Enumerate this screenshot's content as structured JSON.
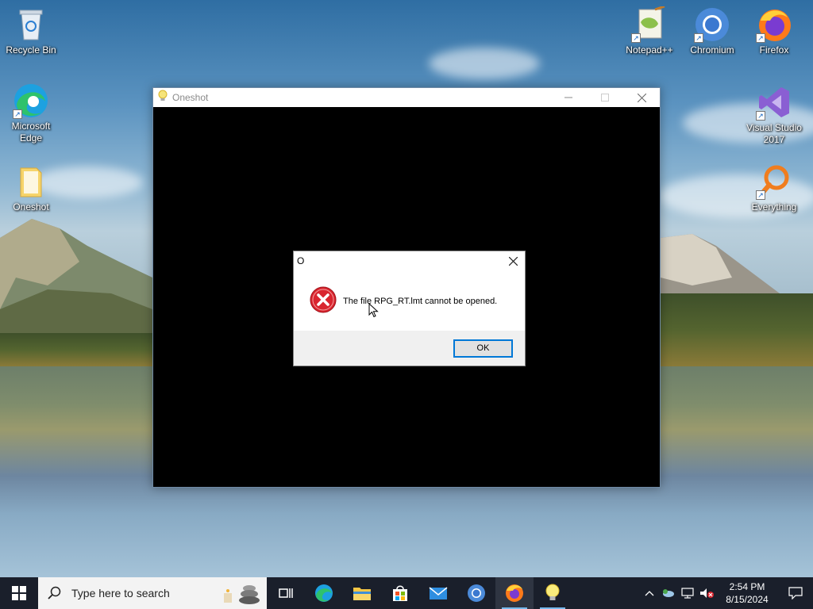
{
  "desktop": {
    "icons_left": [
      {
        "label": "Recycle Bin",
        "icon": "recycle-bin-icon"
      },
      {
        "label": "Microsoft Edge",
        "icon": "edge-icon"
      },
      {
        "label": "Oneshot",
        "icon": "folder-icon"
      }
    ],
    "icons_right": [
      {
        "label": "Notepad++",
        "icon": "notepad-plus-plus-icon"
      },
      {
        "label": "Chromium",
        "icon": "chromium-icon"
      },
      {
        "label": "Firefox",
        "icon": "firefox-icon"
      },
      {
        "label": "Visual Studio 2017",
        "icon": "visual-studio-icon"
      },
      {
        "label": "Everything",
        "icon": "everything-search-icon"
      }
    ]
  },
  "window": {
    "title": "Oneshot",
    "icon": "lightbulb-icon",
    "controls": [
      "minimize",
      "maximize",
      "close"
    ]
  },
  "dialog": {
    "title": "O",
    "message": "The file RPG_RT.lmt cannot be opened.",
    "ok_label": "OK",
    "icon": "error-icon"
  },
  "taskbar": {
    "search_placeholder": "Type here to search",
    "apps": [
      "task-view",
      "edge",
      "file-explorer",
      "store",
      "mail",
      "chromium",
      "firefox",
      "oneshot"
    ],
    "clock_time": "2:54 PM",
    "clock_date": "8/15/2024"
  },
  "colors": {
    "accent": "#0078d7",
    "taskbar": "#1a1f2b",
    "error_red": "#d9252f"
  }
}
